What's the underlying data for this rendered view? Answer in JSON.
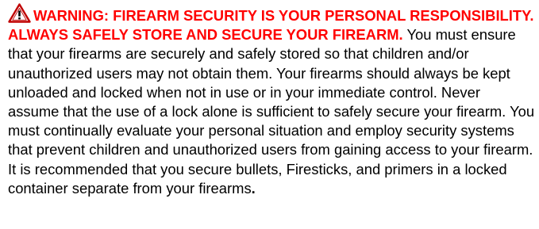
{
  "warning": {
    "icon": "warning-triangle-icon",
    "icon_color": "#c00000",
    "heading": "WARNING: FIREARM SECURITY IS YOUR PERSONAL RESPONSIBILITY. ALWAYS SAFELY STORE AND SECURE YOUR FIREARM.",
    "heading_color": "#ff0000",
    "body": " You must ensure that your firearms are securely and safely stored so that children and/or unauthorized users may not obtain them. Your firearms should always be kept unloaded and locked when not in use or in your immediate control. Never assume that the use of a lock alone is sufficient to safely secure your firearm. You must continually evaluate your personal situation and employ security systems that prevent children and unauthorized users from gaining access to your firearm. It is recommended that you secure bullets, Firesticks, and primers in a locked container separate from your firearms",
    "body_end": ".",
    "body_color": "#000000"
  }
}
